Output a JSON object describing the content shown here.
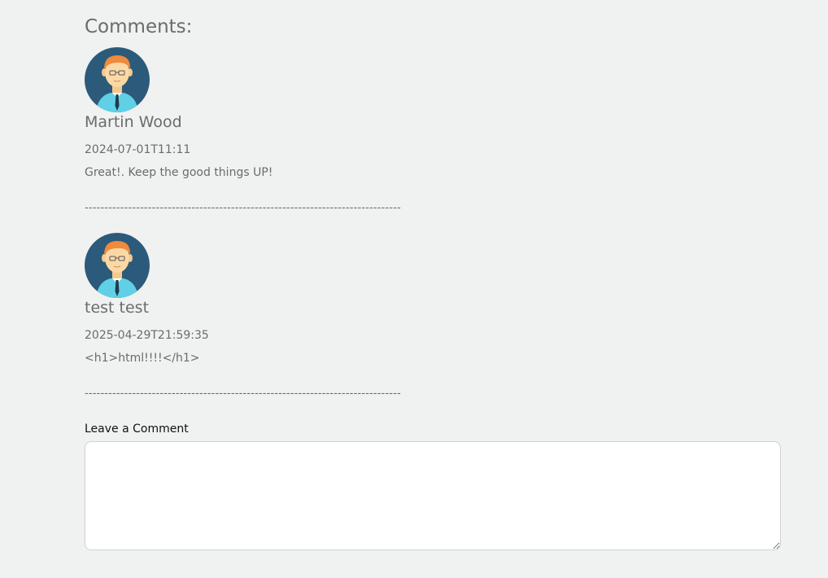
{
  "section": {
    "heading": "Comments:"
  },
  "comments": [
    {
      "author": "Martin Wood",
      "date": "2024-07-01T11:11",
      "text": "Great!. Keep the good things UP!",
      "avatar_icon": "man-with-glasses-avatar-icon"
    },
    {
      "author": "test test",
      "date": "2025-04-29T21:59:35",
      "text": "<h1>html!!!!</h1>",
      "avatar_icon": "man-with-glasses-avatar-icon"
    }
  ],
  "divider": "--------------------------------------------------------------------------------",
  "form": {
    "label": "Leave a Comment",
    "value": ""
  },
  "colors": {
    "background": "#f0f1f1",
    "text": "#6b6b6b",
    "avatar_bg": "#2c5a7a",
    "hair": "#f08a3c",
    "skin": "#fbd9a6",
    "shirt": "#5fd0e6",
    "tie": "#1f3a4d"
  }
}
